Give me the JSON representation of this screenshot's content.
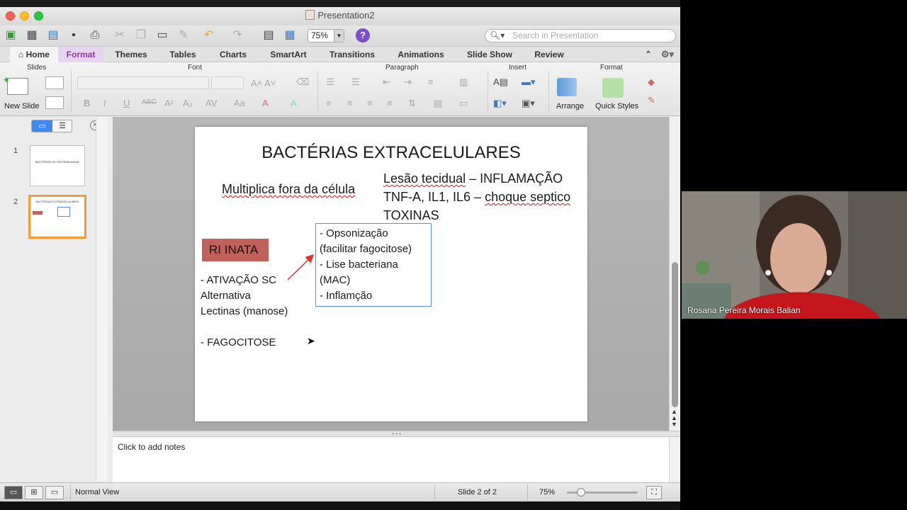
{
  "window": {
    "title": "Presentation2"
  },
  "toolbar": {
    "zoom": "75%",
    "search_placeholder": "Search in Presentation"
  },
  "ribbon_tabs": [
    "Home",
    "Format",
    "Themes",
    "Tables",
    "Charts",
    "SmartArt",
    "Transitions",
    "Animations",
    "Slide Show",
    "Review"
  ],
  "ribbon": {
    "groups": {
      "slides": "Slides",
      "font": "Font",
      "paragraph": "Paragraph",
      "insert": "Insert",
      "format": "Format"
    },
    "new_slide": "New Slide",
    "arrange": "Arrange",
    "quick_styles": "Quick Styles"
  },
  "thumbnails": [
    {
      "number": "1",
      "text": "BACTÉRIAS DO SISTEMA IMUNE"
    },
    {
      "number": "2",
      "text": "BACTÉRIAS EXTRACELULARES"
    }
  ],
  "slide": {
    "title": "BACTÉRIAS EXTRACELULARES",
    "subtitle_left": "Multiplica fora da célula",
    "right_line1_a": "Lesão tecidual",
    "right_line1_b": " – INFLAMAÇÃO",
    "right_line2_a": "TNF-A, IL1, IL6 – ",
    "right_line2_b": "choque septico",
    "right_line3": "TOXINAS",
    "ri_inata": "RI INATA",
    "ativacao": "-   ATIVAÇÃO SC",
    "alternativa": "Alternativa",
    "lectinas": "Lectinas (manose)",
    "fagocitose": "-   FAGOCITOSE",
    "box_lines": [
      "-    Opsonização",
      "(facilitar fagocitose)",
      "-    Lise bacteriana",
      "(MAC)",
      "- Inflamção"
    ]
  },
  "notes": {
    "placeholder": "Click to add notes"
  },
  "status": {
    "view": "Normal View",
    "slide_info": "Slide 2 of 2",
    "zoom": "75%"
  },
  "video": {
    "participant_name": "Rosana Pereira Morais Balian"
  },
  "colors": {
    "accent_selected": "#f29a34",
    "ri_box": "#c0615a",
    "box_border": "#5b8fd6",
    "format_tab": "#8a36b8"
  }
}
